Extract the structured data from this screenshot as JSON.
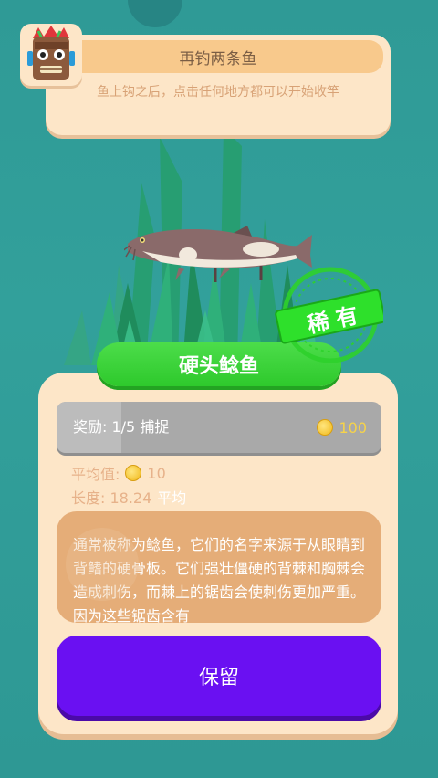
{
  "quest": {
    "title": "再钓两条鱼",
    "hint": "鱼上钩之后，点击任何地方都可以开始收竿"
  },
  "avatar": {
    "icon": "tiki-mask-icon"
  },
  "fish": {
    "name": "硬头鲶鱼",
    "rarity": "稀有",
    "rarity_color": "#2ee02b"
  },
  "reward": {
    "label": "奖励: 1/5 捕捉",
    "progress": 0.2,
    "coins": "100"
  },
  "stats": {
    "average_label": "平均值:",
    "average_value": "10",
    "length_label": "长度: 18.24",
    "length_tag": "平均"
  },
  "description": "通常被称为鲶鱼，它们的名字来源于从眼睛到背鳍的硬骨板。它们强壮僵硬的背棘和胸棘会造成刺伤，而棘上的锯齿会使刺伤更加严重。因为这些锯齿含有",
  "keep_button": "保留",
  "colors": {
    "background": "#2f9a96",
    "card": "#fde6c8",
    "keep_button": "#6a10f2",
    "name_pill": "#2ec92c"
  }
}
